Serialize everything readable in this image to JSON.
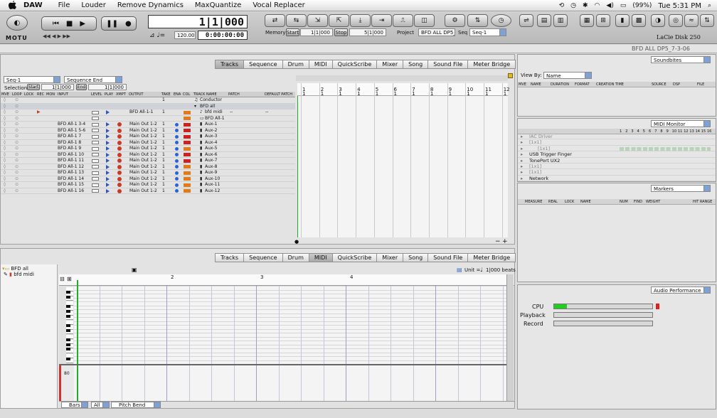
{
  "menubar": {
    "app_name": "DAW",
    "items": [
      "File",
      "Louder",
      "Remove Dynamics",
      "MaxQuantize",
      "Vocal Replacer"
    ],
    "battery": "(99%)",
    "clock": "Tue 5:31 PM"
  },
  "transport": {
    "logo": "MOTU",
    "counter_main": "1|1|000",
    "counter_time": "0:00:00:00",
    "tempo": "120.00",
    "memory_label": "Memory",
    "start_btn": "Start",
    "memory_start_value": "1|1|000",
    "stop_btn": "Stop",
    "memory_stop_value": "5|1|000",
    "project_label": "Project",
    "project_value": "BFD ALL DP5_7-...",
    "seq_label": "Seq",
    "seq_value": "Seq-1",
    "disk_label": "LaCie Disk 250",
    "window_title": "BFD ALL DP5_7-3-06"
  },
  "tracks_window": {
    "tabs": [
      "Tracks",
      "Sequence",
      "Drum",
      "MIDI",
      "QuickScribe",
      "Mixer",
      "Song",
      "Sound File",
      "Meter Bridge"
    ],
    "active_tab": "Tracks",
    "seq_select": "Seq-1",
    "seq_end_select": "Sequence End",
    "selection_label": "Selection",
    "sel_start_label": "Start",
    "sel_start_value": "1|1|000",
    "sel_end_label": "End",
    "sel_end_value": "1|1|000",
    "headers": [
      "MVE",
      "LOOP",
      "LOCK",
      "REC",
      "MON",
      "INPUT",
      "LEVEL",
      "PLAY",
      "XMPT",
      "OUTPUT",
      "TAKE",
      "ENA",
      "COL",
      "TRACK NAME",
      "PATCH",
      "DEFAULT PATCH"
    ],
    "special_rows": [
      {
        "take": "1",
        "name": "Conductor"
      },
      {
        "name": "BFD all"
      },
      {
        "output": "BFD All-1-1",
        "take": "1",
        "name": "bfd midi",
        "patch": "--",
        "default_patch": "--"
      },
      {
        "name": "BFD All-1"
      }
    ],
    "rows": [
      {
        "input": "BFD All-1 3-4",
        "output": "Main Out 1-2",
        "take": "1",
        "name": "Aux-1",
        "color": "#cc2222"
      },
      {
        "input": "BFD All-1 5-6",
        "output": "Main Out 1-2",
        "take": "1",
        "name": "Aux-2",
        "color": "#cc2222"
      },
      {
        "input": "BFD All-1 7",
        "output": "Main Out 1-2",
        "take": "1",
        "name": "Aux-3",
        "color": "#cc2222"
      },
      {
        "input": "BFD All-1 8",
        "output": "Main Out 1-2",
        "take": "1",
        "name": "Aux-4",
        "color": "#cc2222"
      },
      {
        "input": "BFD All-1 9",
        "output": "Main Out 1-2",
        "take": "1",
        "name": "Aux-5",
        "color": "#e07a1a"
      },
      {
        "input": "BFD All-1 10",
        "output": "Main Out 1-2",
        "take": "1",
        "name": "Aux-6",
        "color": "#cc2222"
      },
      {
        "input": "BFD All-1 11",
        "output": "Main Out 1-2",
        "take": "1",
        "name": "Aux-7",
        "color": "#cc2222"
      },
      {
        "input": "BFD All-1 12",
        "output": "Main Out 1-2",
        "take": "1",
        "name": "Aux-8",
        "color": "#e07a1a"
      },
      {
        "input": "BFD All-1 13",
        "output": "Main Out 1-2",
        "take": "1",
        "name": "Aux-9",
        "color": "#e07a1a"
      },
      {
        "input": "BFD All-1 14",
        "output": "Main Out 1-2",
        "take": "1",
        "name": "Aux-10",
        "color": "#e07a1a"
      },
      {
        "input": "BFD All-1 15",
        "output": "Main Out 1-2",
        "take": "1",
        "name": "Aux-11",
        "color": "#e07a1a"
      },
      {
        "input": "BFD All-1 16",
        "output": "Main Out 1-2",
        "take": "1",
        "name": "Aux-12",
        "color": "#e07a1a"
      }
    ],
    "ruler_numbers": [
      "1",
      "2",
      "3",
      "4",
      "5",
      "6",
      "7",
      "8",
      "9",
      "10",
      "11",
      "12"
    ]
  },
  "midi_window": {
    "tabs": [
      "Tracks",
      "Sequence",
      "Drum",
      "MIDI",
      "QuickScribe",
      "Mixer",
      "Song",
      "Sound File",
      "Meter Bridge"
    ],
    "active_tab": "MIDI",
    "tree_group": "BFD all",
    "tree_track": "bfd midi",
    "unit_label": "Unit =",
    "unit_value": "1|000 beats",
    "ruler_numbers": [
      "2",
      "3",
      "4"
    ],
    "velocity_tick": "80",
    "bottom_bars": "Bars",
    "bottom_all": "All",
    "bottom_pitch": "Pitch Bend"
  },
  "soundbites": {
    "select": "Soundbites",
    "view_by_label": "View By:",
    "view_by_value": "Name",
    "headers": [
      "MVE",
      "NAME",
      "DURATION",
      "FORMAT",
      "CREATION TIME",
      "SOURCE",
      "DSP",
      "FILE"
    ]
  },
  "midi_monitor": {
    "select": "MIDI Monitor",
    "channels": [
      "1",
      "2",
      "3",
      "4",
      "5",
      "6",
      "7",
      "8",
      "9",
      "10",
      "11",
      "12",
      "13",
      "14",
      "15",
      "16"
    ],
    "rows": [
      "IAC Driver",
      "[1x1]",
      "[1x1]",
      "USB Trigger Finger",
      "TonePort UX2",
      "[1x1]",
      "[1x1]",
      "Network"
    ]
  },
  "markers": {
    "select": "Markers",
    "headers": [
      "MEASURE",
      "REAL",
      "LOCK",
      "NAME",
      "NUM",
      "FIND",
      "WEIGHT",
      "HIT RANGE"
    ]
  },
  "audio_performance": {
    "select": "Audio Performance",
    "cpu_label": "CPU",
    "playback_label": "Playback",
    "record_label": "Record",
    "cpu_fraction": 0.13,
    "cpu_color": "#22cc22"
  }
}
